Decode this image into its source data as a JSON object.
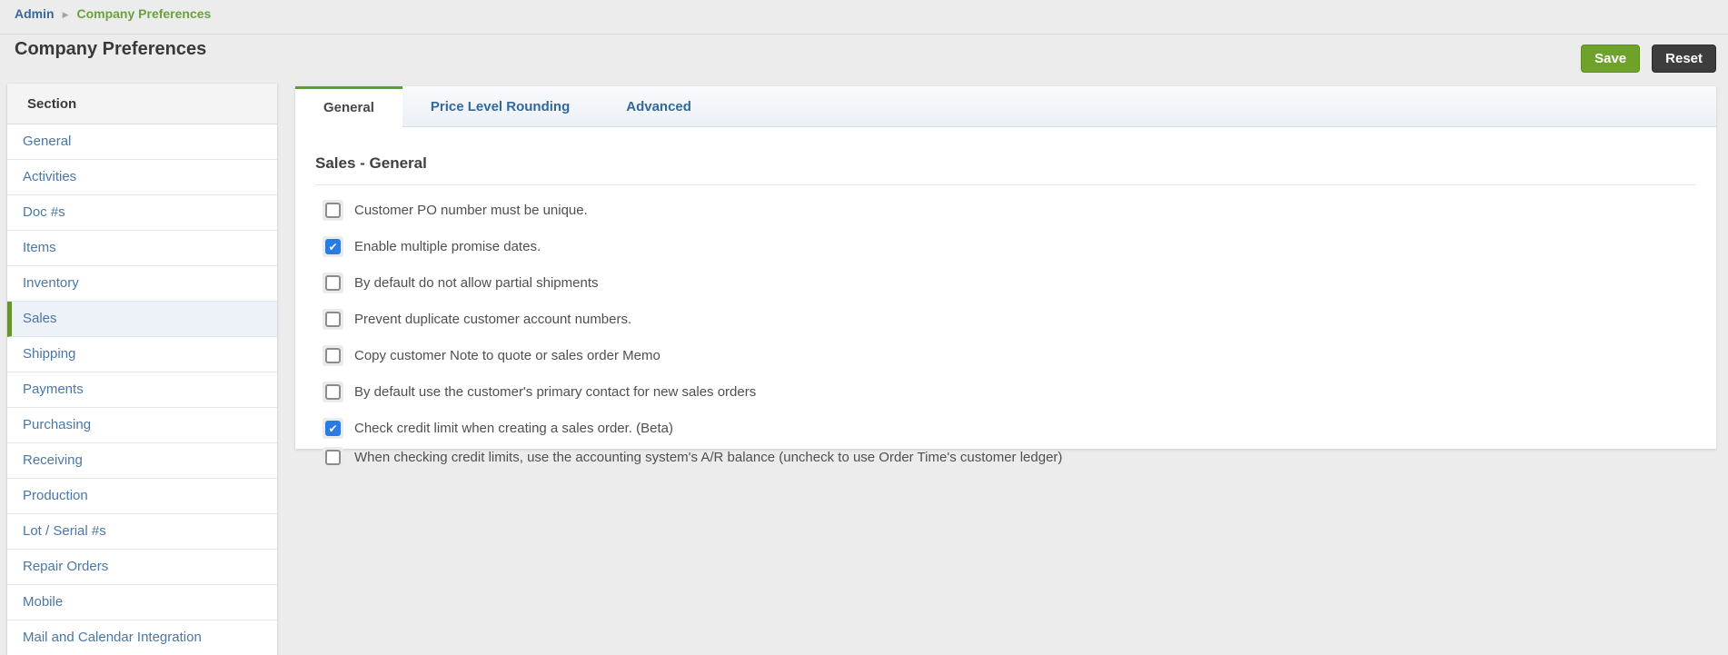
{
  "breadcrumb": {
    "separator": "▶",
    "items": [
      {
        "label": "Admin"
      },
      {
        "label": "Company Preferences"
      }
    ]
  },
  "page": {
    "title": "Company Preferences"
  },
  "toolbar": {
    "save_label": "Save",
    "reset_label": "Reset"
  },
  "sidebar": {
    "header": "Section",
    "items": [
      {
        "label": "General",
        "selected": false
      },
      {
        "label": "Activities",
        "selected": false
      },
      {
        "label": "Doc #s",
        "selected": false
      },
      {
        "label": "Items",
        "selected": false
      },
      {
        "label": "Inventory",
        "selected": false
      },
      {
        "label": "Sales",
        "selected": true
      },
      {
        "label": "Shipping",
        "selected": false
      },
      {
        "label": "Payments",
        "selected": false
      },
      {
        "label": "Purchasing",
        "selected": false
      },
      {
        "label": "Receiving",
        "selected": false
      },
      {
        "label": "Production",
        "selected": false
      },
      {
        "label": "Lot / Serial #s",
        "selected": false
      },
      {
        "label": "Repair Orders",
        "selected": false
      },
      {
        "label": "Mobile",
        "selected": false
      },
      {
        "label": "Mail and Calendar Integration",
        "selected": false
      }
    ]
  },
  "tabs": [
    {
      "label": "General",
      "active": true
    },
    {
      "label": "Price Level Rounding",
      "active": false
    },
    {
      "label": "Advanced",
      "active": false
    }
  ],
  "section": {
    "heading": "Sales - General",
    "checkboxes": [
      {
        "label": "Customer PO number must be unique.",
        "checked": false
      },
      {
        "label": "Enable multiple promise dates.",
        "checked": true
      },
      {
        "label": "By default do not allow partial shipments",
        "checked": false
      },
      {
        "label": "Prevent duplicate customer account numbers.",
        "checked": false
      },
      {
        "label": "Copy customer Note to quote or sales order Memo",
        "checked": false
      },
      {
        "label": "By default use the customer's primary contact for new sales orders",
        "checked": false
      },
      {
        "label": "Check credit limit when creating a sales order. (Beta)",
        "checked": true
      },
      {
        "label": "When checking credit limits, use the accounting system's A/R balance (uncheck to use Order Time's customer ledger)",
        "checked": false
      }
    ]
  },
  "colors": {
    "page_background": "#ececec",
    "save_button": "#6fa22b",
    "reset_button": "#3d3d3d",
    "breadcrumb_link": "#35689b",
    "breadcrumb_current": "#69a23c",
    "sidebar_link": "#4a77a5",
    "selected_accent_green": "#649433",
    "active_tab_border": "#5c9c31",
    "checkbox_checked": "#2a7ce2"
  }
}
